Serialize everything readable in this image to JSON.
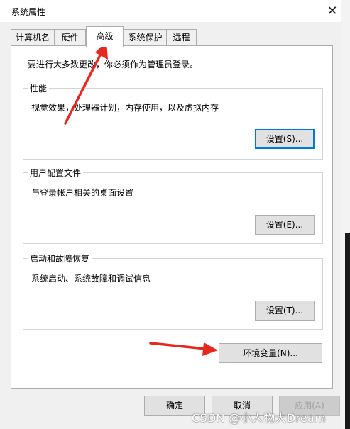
{
  "window": {
    "title": "系统属性",
    "close_icon": "close-icon"
  },
  "tabs": [
    {
      "label": "计算机名",
      "active": false
    },
    {
      "label": "硬件",
      "active": false
    },
    {
      "label": "高级",
      "active": true
    },
    {
      "label": "系统保护",
      "active": false
    },
    {
      "label": "远程",
      "active": false
    }
  ],
  "advanced": {
    "admin_notice": "要进行大多数更改，你必须作为管理员登录。",
    "performance": {
      "title": "性能",
      "description": "视觉效果，处理器计划，内存使用，以及虚拟内存",
      "button": "设置(S)..."
    },
    "user_profiles": {
      "title": "用户配置文件",
      "description": "与登录帐户相关的桌面设置",
      "button": "设置(E)..."
    },
    "startup_recovery": {
      "title": "启动和故障恢复",
      "description": "系统启动、系统故障和调试信息",
      "button": "设置(T)..."
    },
    "env_vars_button": "环境变量(N)..."
  },
  "footer": {
    "ok": "确定",
    "cancel": "取消",
    "apply": "应用(A)"
  },
  "watermark": "CSDN @小人物大Dream",
  "colors": {
    "annotation_arrow": "#e8281f",
    "focus_border": "#0078d7"
  }
}
